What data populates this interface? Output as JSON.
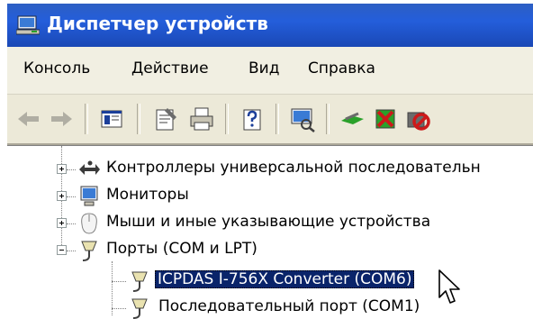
{
  "window": {
    "title": "Диспетчер устройств"
  },
  "menu": {
    "items": [
      {
        "label": "Консоль"
      },
      {
        "label": "Действие"
      },
      {
        "label": "Вид"
      },
      {
        "label": "Справка"
      }
    ]
  },
  "toolbar": {
    "icons": [
      "back-arrow-icon",
      "forward-arrow-icon",
      "show-hide-tree-icon",
      "properties-icon",
      "print-icon",
      "help-icon",
      "scan-hardware-icon",
      "update-driver-icon",
      "uninstall-icon",
      "disable-icon"
    ]
  },
  "tree": {
    "controllers": "Контроллеры универсальной последовательн",
    "monitors": "Мониторы",
    "mice": "Мыши и иные указывающие устройства",
    "ports": "Порты (COM и LPT)",
    "port_selected": "ICPDAS I-756X Converter (COM6)",
    "port_serial": "Последовательный порт (COM1)"
  },
  "colors": {
    "selection": "#0a246a",
    "titlebar": "#245edb"
  }
}
